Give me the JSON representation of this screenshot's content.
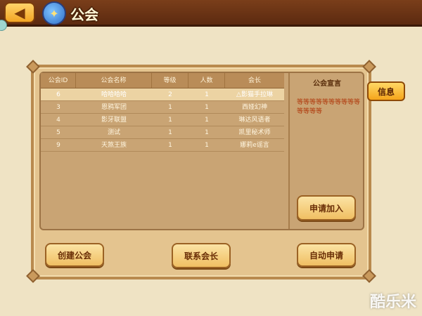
{
  "header": {
    "title": "公会",
    "back_icon": "back-arrow-icon",
    "guild_icon": "guild-emblem-icon"
  },
  "table": {
    "headers": [
      "公会ID",
      "公会名称",
      "等级",
      "人数",
      "会长"
    ],
    "rows": [
      [
        "6",
        "哈哈哈哈",
        "2",
        "1",
        "△影猫手拉琳"
      ],
      [
        "3",
        "恩鸦军团",
        "1",
        "1",
        "西娅幻神"
      ],
      [
        "4",
        "影牙联盟",
        "1",
        "1",
        "琳达风语者"
      ],
      [
        "5",
        "测试",
        "1",
        "1",
        "凯里秘术师"
      ],
      [
        "9",
        "天煞王族",
        "1",
        "1",
        "娜莉e谣言"
      ]
    ],
    "selected_row": 0
  },
  "declaration": {
    "title": "公会宣言",
    "text": "等等等等等等等等等等等等等等"
  },
  "buttons": {
    "info": "信息",
    "apply_join": "申请加入",
    "create_guild": "创建公会",
    "contact_leader": "联系会长",
    "auto_apply": "自动申请"
  },
  "watermark": "酷乐米",
  "colors": {
    "topbar": "#6b3314",
    "panel": "#c9a474",
    "button": "#f0bf63",
    "declaration_text": "#b03a0e"
  }
}
